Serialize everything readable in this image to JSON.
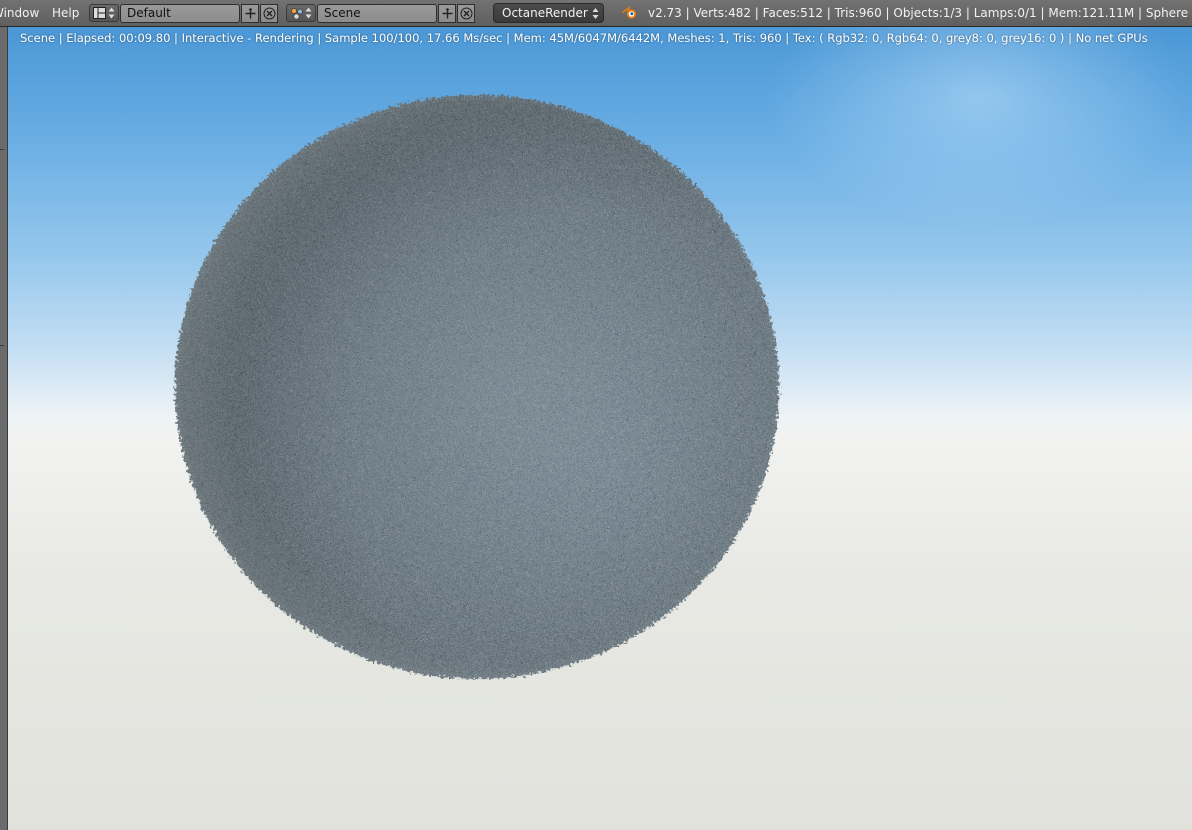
{
  "menu": {
    "window_label": "Window",
    "help_label": "Help"
  },
  "screen_layout": {
    "value": "Default"
  },
  "scene_selector": {
    "value": "Scene"
  },
  "render_engine": {
    "value": "OctaneRender"
  },
  "info_stats": "v2.73 | Verts:482 | Faces:512 | Tris:960 | Objects:1/3 | Lamps:0/1 | Mem:121.11M | Sphere",
  "viewport": {
    "render_status": "Scene | Elapsed: 00:09.80 | Interactive - Rendering | Sample 100/100, 17.66 Ms/sec | Mem: 45M/6047M/6442M, Meshes: 1, Tris: 960 | Tex: ( Rgb32: 0, Rgb64: 0, grey8: 0, grey16: 0 ) | No net GPUs"
  },
  "colors": {
    "header_bg": "#666666",
    "field_bg": "#939393",
    "dropdown_bg": "#404040",
    "blender_logo": "#e87d0d",
    "fur_base": "#5f717d",
    "sky_top": "#4a97d6",
    "ground": "#e1e2dc"
  },
  "icons": {
    "screen_layout": "screen-layout-icon",
    "scene": "scene-icon",
    "add": "plus-icon",
    "close": "x-icon",
    "dropdown_arrows": "up-down-arrows-icon",
    "blender": "blender-logo-icon"
  }
}
